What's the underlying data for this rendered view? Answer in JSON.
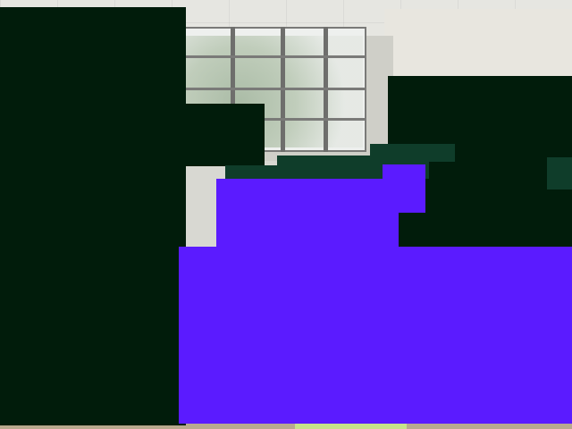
{
  "scene": {
    "description_label": "",
    "colors": {
      "mask_dark": "#011c0b",
      "mask_teal": "#0f3d2a",
      "mask_purple": "#5b1bff",
      "floor_mat": "#c8e28a"
    }
  }
}
